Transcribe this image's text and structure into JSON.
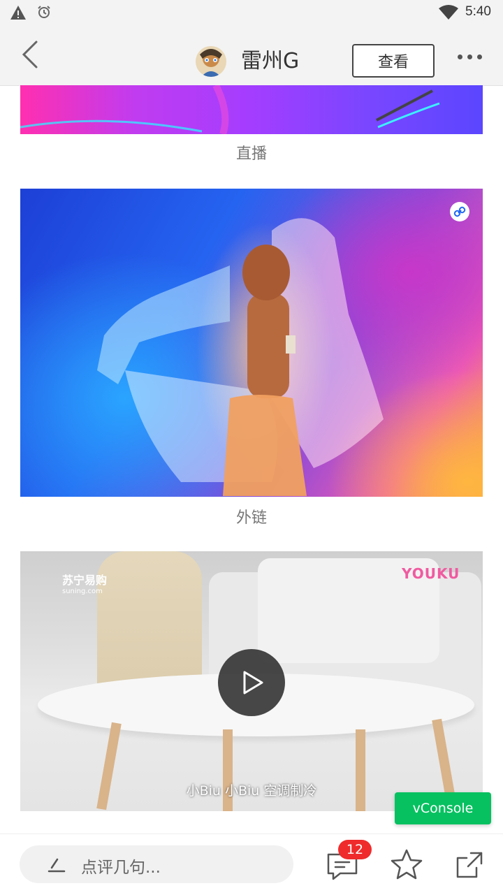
{
  "status_bar": {
    "time": "5:40",
    "icons": [
      "warning-icon",
      "alarm-icon",
      "wifi-icon"
    ]
  },
  "header": {
    "back_icon": "chevron-left-icon",
    "title": "雷州G",
    "view_label": "查看",
    "more_icon": "more-dots-icon"
  },
  "content": {
    "sections": [
      {
        "caption": "直播",
        "kind": "live"
      },
      {
        "caption": "外链",
        "kind": "link",
        "badge_icon": "link-icon"
      },
      {
        "kind": "video",
        "watermark_left": "苏宁易购",
        "watermark_left_sub": "suning.com",
        "watermark_right": "YOUKU",
        "subtitle": "小Biu 小Biu 空调制冷",
        "play_icon": "play-icon"
      }
    ]
  },
  "vconsole": {
    "label": "vConsole"
  },
  "bottom_bar": {
    "comment_placeholder": "点评几句...",
    "comment_count": "12",
    "icons": [
      "pen-icon",
      "comments-icon",
      "star-icon",
      "share-icon"
    ]
  },
  "colors": {
    "badge": "#ef2b2b",
    "vconsole": "#07c160",
    "youku": "#f05aa0"
  }
}
